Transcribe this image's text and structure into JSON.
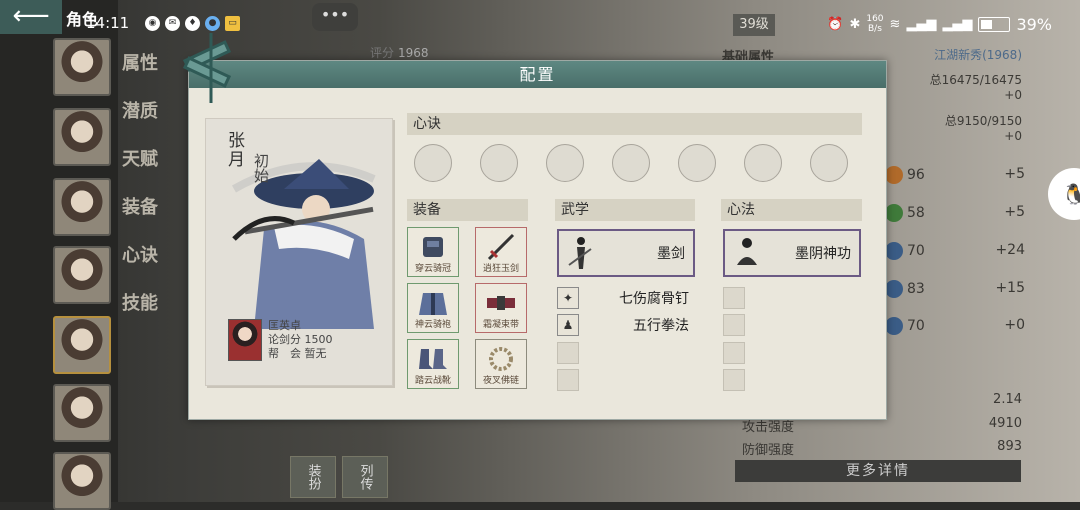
{
  "status_bar": {
    "time": "14:11",
    "net_speed_value": "160",
    "net_speed_unit": "B/s",
    "battery": "39%",
    "app_icons": [
      "wechat-icon",
      "message-icon",
      "app-icon",
      "circle-app-icon",
      "mail-icon"
    ]
  },
  "top": {
    "back_symbol": "⟵",
    "title": "角色",
    "chat_symbol": "•••",
    "level": "39级",
    "power_label": "评分",
    "power_value": "1968"
  },
  "left_tabs": [
    "属性",
    "潜质",
    "天赋",
    "装备",
    "心诀",
    "技能"
  ],
  "background_stats": {
    "basic_label": "基础属性",
    "rank": "江湖新秀(1968)",
    "hp": "总16475/16475",
    "hp_plus": "+0",
    "mp": "总9150/9150",
    "mp_plus": "+0",
    "attrs": [
      {
        "value": "96",
        "plus": "+5",
        "color": "#b06a2a"
      },
      {
        "value": "58",
        "plus": "+5",
        "color": "#3f7a3a"
      },
      {
        "value": "70",
        "plus": "+24",
        "color": "#3a5c86"
      },
      {
        "value": "83",
        "plus": "+15",
        "color": "#3a5c86"
      },
      {
        "value": "70",
        "plus": "+0",
        "color": "#3a5c86"
      }
    ],
    "bottom": [
      {
        "label": "",
        "value": "2.14"
      },
      {
        "label": "攻击强度",
        "value": "4910"
      },
      {
        "label": "防御强度",
        "value": "893"
      }
    ],
    "more_details": "更多详情"
  },
  "bottom_tabs": [
    "装扮",
    "列传"
  ],
  "modal": {
    "title": "配置",
    "character": {
      "name": "张月",
      "title": "初始",
      "owner_name": "匡英卓",
      "owner_score": "论剑分 1500",
      "owner_guild": "帮　会 暂无"
    },
    "sections": {
      "heart": "心诀",
      "equipment": "装备",
      "martial": "武学",
      "method": "心法"
    },
    "equipment": [
      {
        "name": "穿云骑冠",
        "type": "armor"
      },
      {
        "name": "逍狂玉剑",
        "type": "sword"
      },
      {
        "name": "神云骑袍",
        "type": "robe"
      },
      {
        "name": "霜凝束带",
        "type": "belt"
      },
      {
        "name": "踏云战靴",
        "type": "boots"
      },
      {
        "name": "夜叉佛链",
        "type": "beads"
      }
    ],
    "martial": {
      "main": "墨剑",
      "subs": [
        "七伤腐骨钉",
        "五行拳法"
      ]
    },
    "method": {
      "main": "墨阴神功"
    }
  }
}
